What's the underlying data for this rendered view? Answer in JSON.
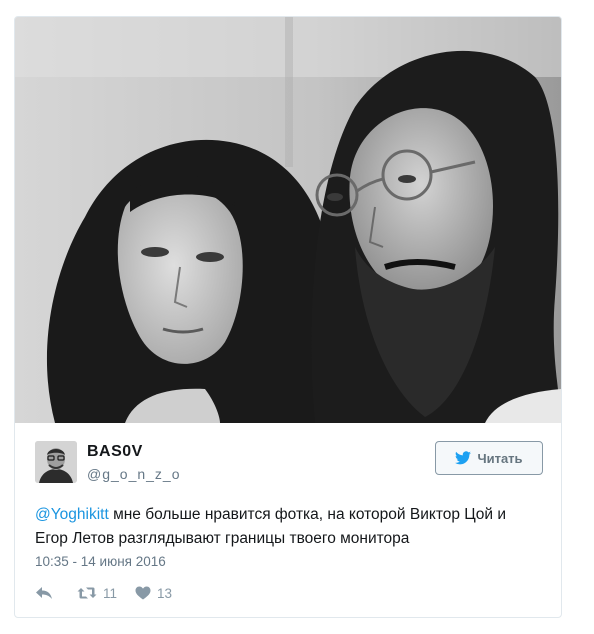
{
  "photo": {
    "icon": "black-and-white-portrait-photo"
  },
  "author": {
    "display_name": "BAS0V",
    "handle": "@g_o_n_z_o",
    "avatar_icon": "user-avatar"
  },
  "follow_button": {
    "label": "Читать",
    "icon": "twitter-bird-icon"
  },
  "tweet": {
    "mention": "@Yoghikitt",
    "text": " мне больше нравится фотка, на которой Виктор Цой и Егор Летов разглядывают границы твоего монитора",
    "timestamp": "10:35 - 14 июня 2016"
  },
  "actions": {
    "reply_icon": "reply-icon",
    "retweet_icon": "retweet-icon",
    "retweet_count": "11",
    "like_icon": "heart-icon",
    "like_count": "13"
  },
  "colors": {
    "accent": "#1b95e0",
    "bird": "#1da1f2",
    "muted": "#657786",
    "border": "#e1e8ed"
  }
}
